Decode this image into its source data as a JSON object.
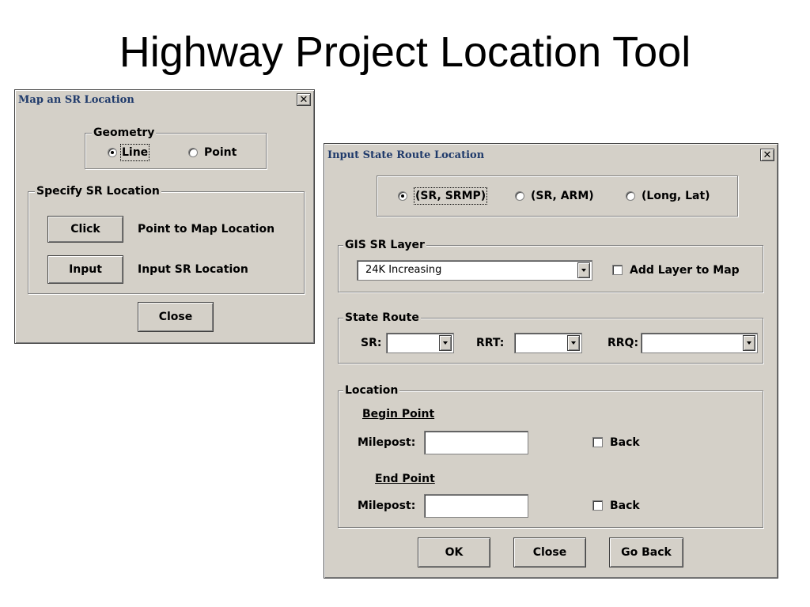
{
  "slide": {
    "title": "Highway Project Location Tool"
  },
  "map_dialog": {
    "title": "Map an SR Location",
    "geometry": {
      "legend": "Geometry",
      "options": [
        "Line",
        "Point"
      ],
      "selected": "Line"
    },
    "specify": {
      "legend": "Specify SR Location",
      "click_button": "Click",
      "click_desc": "Point to Map Location",
      "input_button": "Input",
      "input_desc": "Input SR Location"
    },
    "close_button": "Close"
  },
  "input_dialog": {
    "title": "Input State Route Location",
    "mode": {
      "options": [
        "(SR, SRMP)",
        "(SR, ARM)",
        "(Long, Lat)"
      ],
      "selected": "(SR, SRMP)"
    },
    "gis": {
      "legend": "GIS SR Layer",
      "layer_value": "24K Increasing",
      "add_layer_label": "Add Layer to Map",
      "add_layer_checked": false
    },
    "state_route": {
      "legend": "State Route",
      "sr_label": "SR:",
      "rrt_label": "RRT:",
      "rrq_label": "RRQ:"
    },
    "location": {
      "legend": "Location",
      "begin_heading": "Begin Point",
      "begin_milepost_label": "Milepost:",
      "begin_back_label": "Back",
      "end_heading": "End Point",
      "end_milepost_label": "Milepost:",
      "end_back_label": "Back"
    },
    "buttons": {
      "ok": "OK",
      "close": "Close",
      "go_back": "Go Back"
    }
  }
}
